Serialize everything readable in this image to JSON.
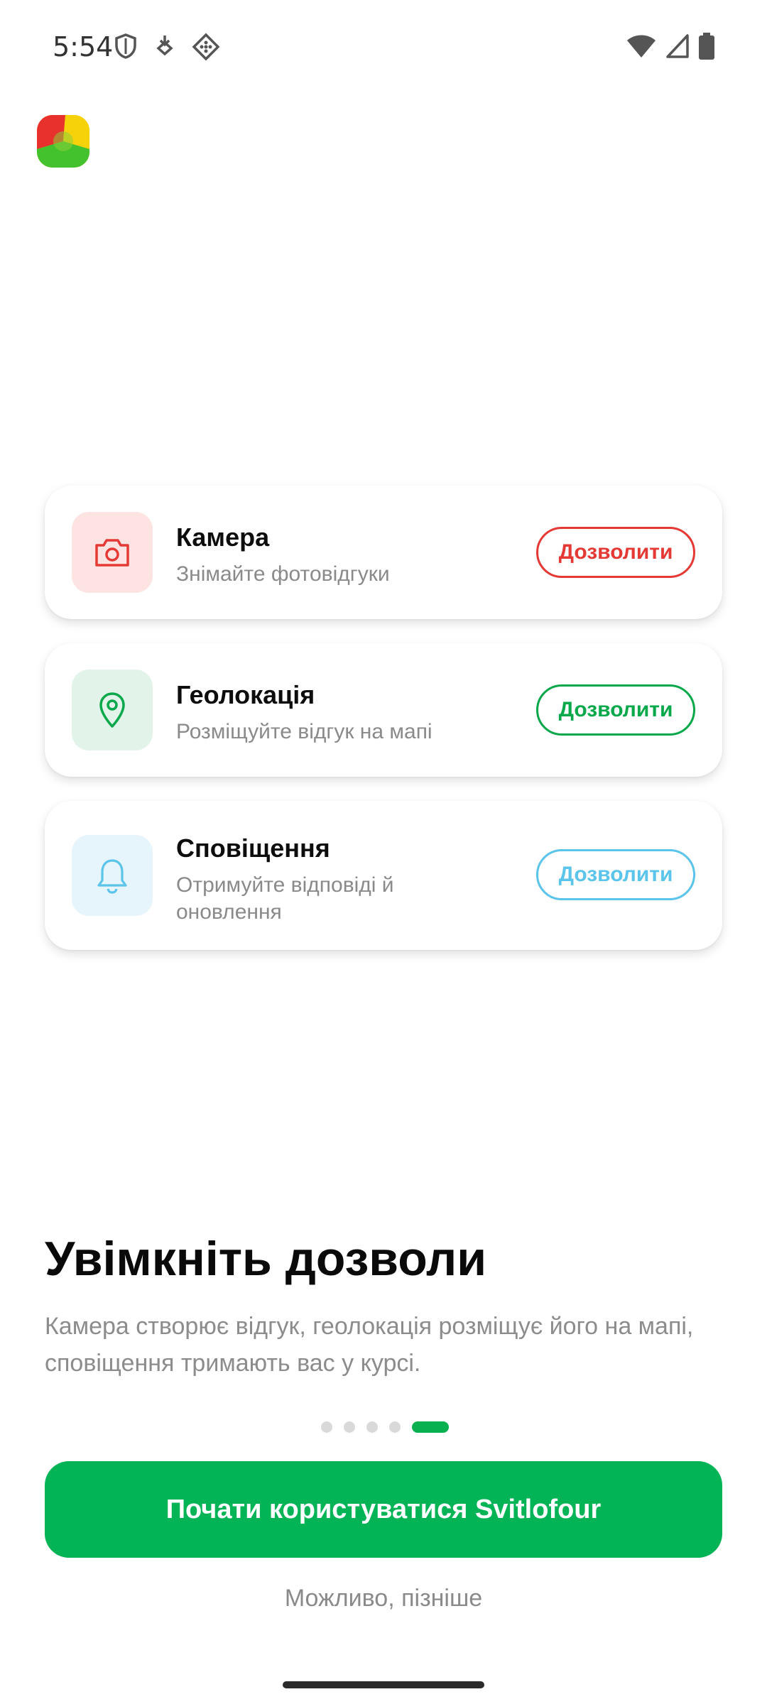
{
  "status_bar": {
    "time": "5:54",
    "icons": [
      "shield-icon",
      "download-icon",
      "nfc-icon",
      "wifi-icon",
      "signal-icon",
      "battery-icon"
    ]
  },
  "app": {
    "logo": "app-logo"
  },
  "permissions": [
    {
      "id": "camera",
      "title": "Камера",
      "subtitle": "Знімайте фотовідгуки",
      "button": "Дозволити",
      "icon": "camera-icon",
      "accent": "#e53935"
    },
    {
      "id": "geo",
      "title": "Геолокація",
      "subtitle": "Розміщуйте відгук на мапі",
      "button": "Дозволити",
      "icon": "location-pin-icon",
      "accent": "#09a84a"
    },
    {
      "id": "notifications",
      "title": "Сповіщення",
      "subtitle": "Отримуйте відповіді й оновлення",
      "button": "Дозволити",
      "icon": "bell-icon",
      "accent": "#5bc4ea"
    }
  ],
  "heading": "Увімкніть дозволи",
  "description": "Камера створює відгук, геолокація розміщує його на мапі, сповіщення тримають вас у курсі.",
  "pager": {
    "total": 5,
    "active": 5
  },
  "primary_button": "Почати користуватися Svitlofour",
  "secondary_link": "Можливо, пізніше",
  "colors": {
    "primary": "#02b455",
    "camera": "#e53935",
    "geo": "#09a84a",
    "notifications": "#5bc4ea"
  }
}
